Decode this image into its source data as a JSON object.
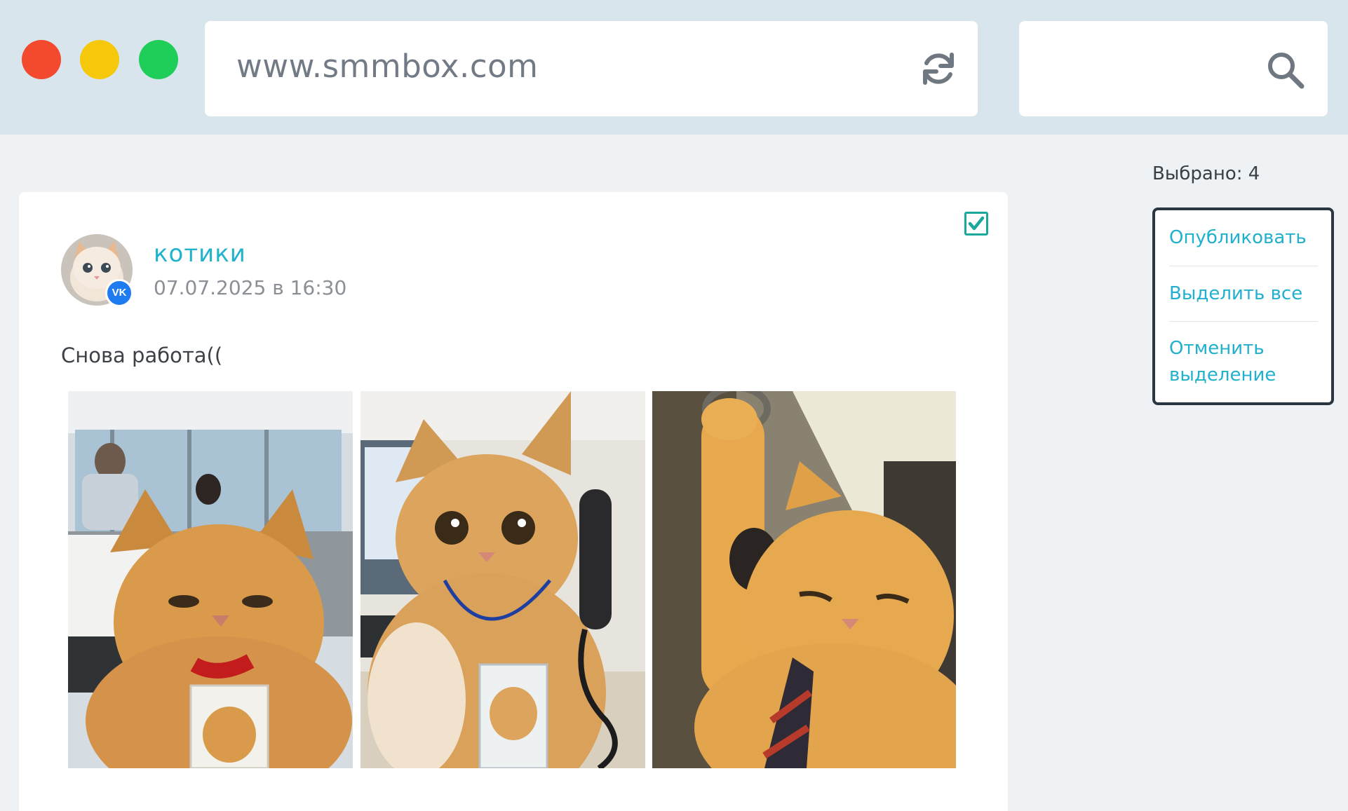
{
  "browser": {
    "url": "www.smmbox.com",
    "search_value": "",
    "icons": [
      "reload-icon",
      "search-icon"
    ]
  },
  "post": {
    "group_name": "котики",
    "date": "07.07.2025 в 16:30",
    "text": "Снова работа((",
    "selected": true,
    "network_badge": "vk",
    "photos": [
      "cat-office-photo",
      "cat-phone-photo",
      "cat-subway-photo"
    ]
  },
  "panel": {
    "selected_label": "Выбрано: 4",
    "actions": [
      "Опубликовать",
      "Выделить все",
      "Отменить выделение"
    ]
  },
  "colors": {
    "accent": "#21b3cc",
    "checkbox": "#1aa89c",
    "vk": "#1f7cf0",
    "panel_border": "#2a3642"
  }
}
